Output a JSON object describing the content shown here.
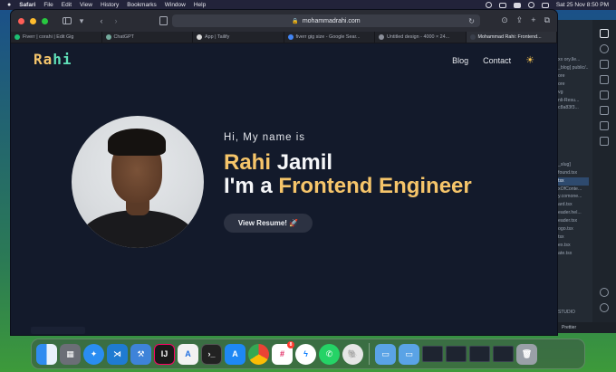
{
  "menubar": {
    "app": "Safari",
    "items": [
      "File",
      "Edit",
      "View",
      "History",
      "Bookmarks",
      "Window",
      "Help"
    ],
    "clock": "Sat 25 Nov 8:50 PM"
  },
  "browser": {
    "url": "mohammadrahi.com",
    "tabs": [
      {
        "label": "Fiverr | corahi | Edit Gig",
        "color": "#1dbf73"
      },
      {
        "label": "ChatGPT",
        "color": "#74aa9c"
      },
      {
        "label": "App | Tailify",
        "color": "#d9d9d9"
      },
      {
        "label": "fiverr gig size - Google Sear...",
        "color": "#4285f4"
      },
      {
        "label": "Untitled design - 4000 × 24...",
        "color": "#8b8f9a"
      },
      {
        "label": "Mohammad Rahi: Frontend...",
        "color": "#3a3f4b",
        "active": true
      }
    ]
  },
  "site": {
    "logo": "Rahi",
    "nav": {
      "blog": "Blog",
      "contact": "Contact"
    },
    "greeting": "Hi, My name is",
    "first_name": "Rahi",
    "last_name": "Jamil",
    "role_prefix": "I'm a",
    "role": "Frontend Engineer",
    "resume_button": "View Resume! 🚀"
  },
  "editor": {
    "files": [
      "xx ory.lle...",
      "_blog] public/...",
      "ore",
      "ore",
      "vg",
      "nli-Resu...",
      "c8a83f3...",
      "",
      "",
      "",
      "",
      "",
      "",
      "_slug]",
      "found.tsx",
      "tsx",
      "xOfConte...",
      "y.comone...",
      "ard.tsx",
      "eader.hel...",
      "eader.tsx",
      "ogo.tsx",
      "tsx",
      "ex.tsx",
      "ate.tsx"
    ],
    "selected_index": 15,
    "studio_label": "STUDIO",
    "status": "Prettier"
  },
  "dock": {
    "badge": "8"
  }
}
